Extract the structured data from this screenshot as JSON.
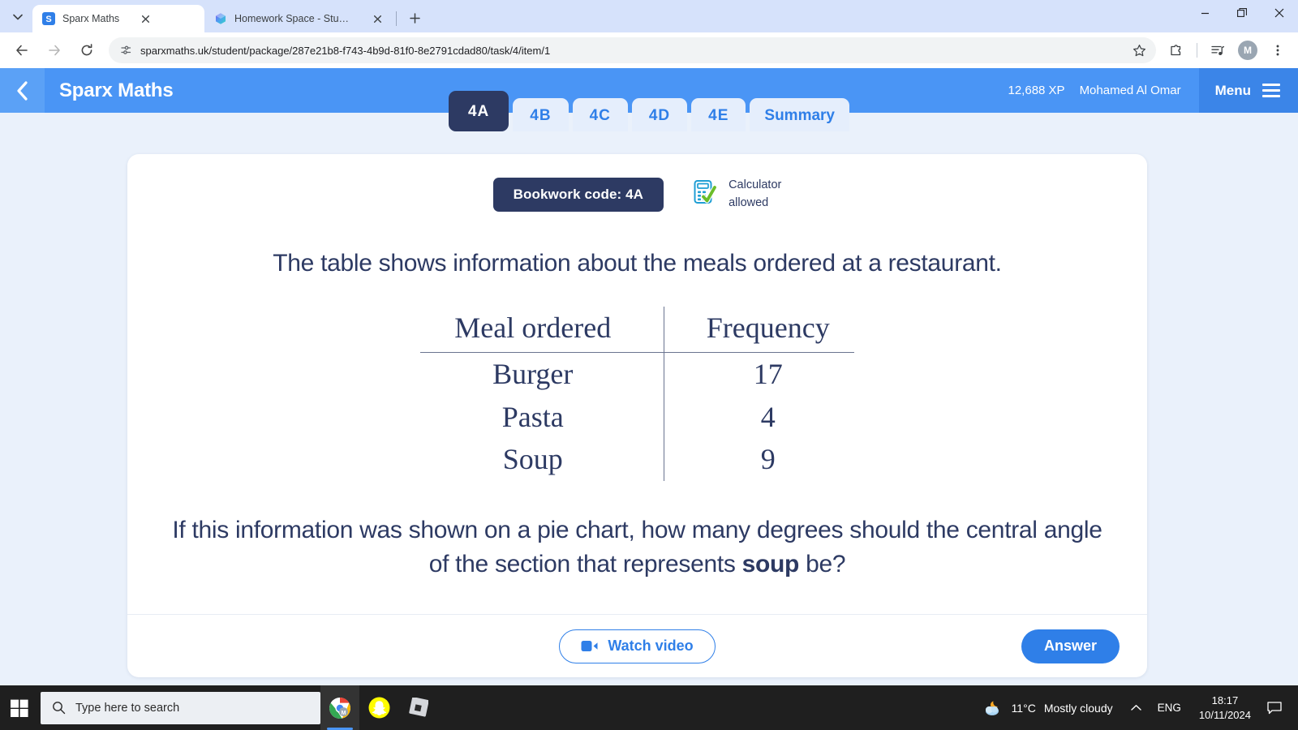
{
  "browser": {
    "tabs": [
      {
        "title": "Sparx Maths",
        "favicon": "sparx-s-icon",
        "active": true
      },
      {
        "title": "Homework Space - StudyX",
        "favicon": "studyx-cube-icon",
        "active": false
      }
    ],
    "new_tab_label": "+",
    "url": "sparxmaths.uk/student/package/287e21b8-f743-4b9d-81f0-8e2791cdad80/task/4/item/1",
    "toolbar_icons": [
      "back-arrow-icon",
      "forward-arrow-icon",
      "reload-icon",
      "site-settings-icon",
      "bookmark-star-icon",
      "extensions-puzzle-icon",
      "media-control-icon",
      "profile-avatar",
      "chrome-menu-icon"
    ],
    "profile_initial": "M",
    "window_controls": [
      "minimize-icon",
      "restore-icon",
      "close-icon"
    ]
  },
  "app": {
    "brand": "Sparx Maths",
    "back_icon": "chevron-left-icon",
    "xp": "12,688 XP",
    "user": "Mohamed Al Omar",
    "menu_label": "Menu",
    "menu_icon": "hamburger-icon",
    "accent_blue": "#4a95f5",
    "dark_navy": "#2d3a63"
  },
  "question_tabs": [
    {
      "label": "4A",
      "active": true
    },
    {
      "label": "4B",
      "active": false
    },
    {
      "label": "4C",
      "active": false
    },
    {
      "label": "4D",
      "active": false
    },
    {
      "label": "4E",
      "active": false
    },
    {
      "label": "Summary",
      "active": false
    }
  ],
  "card": {
    "bookwork_code": "Bookwork code: 4A",
    "calculator_icon": "calculator-check-icon",
    "calculator_line1": "Calculator",
    "calculator_line2": "allowed",
    "intro_text": "The table shows information about the meals ordered at a restaurant.",
    "table": {
      "headers": [
        "Meal ordered",
        "Frequency"
      ],
      "rows": [
        [
          "Burger",
          "17"
        ],
        [
          "Pasta",
          "4"
        ],
        [
          "Soup",
          "9"
        ]
      ]
    },
    "question_part1": "If this information was shown on a pie chart, how many degrees should the central angle of the section that represents ",
    "question_emphasis": "soup",
    "question_part2": " be?",
    "watch_video_label": "Watch video",
    "watch_video_icon": "video-camera-icon",
    "answer_label": "Answer"
  },
  "taskbar": {
    "start_icon": "windows-start-icon",
    "search_placeholder": "Type here to search",
    "search_icon": "magnifier-icon",
    "apps": [
      {
        "name": "chrome-icon"
      },
      {
        "name": "snapchat-icon"
      },
      {
        "name": "roblox-icon"
      }
    ],
    "weather_icon": "night-cloudy-icon",
    "temperature": "11°C",
    "weather_text": "Mostly cloudy",
    "tray_expand_icon": "chevron-up-icon",
    "language": "ENG",
    "time": "18:17",
    "date": "10/11/2024",
    "notification_icon": "notification-bubble-icon"
  }
}
